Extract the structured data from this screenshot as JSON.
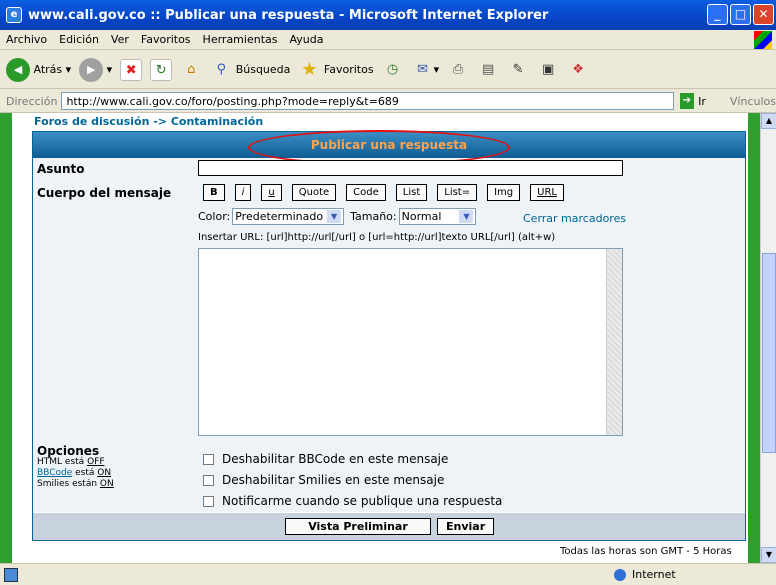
{
  "window": {
    "title": "www.cali.gov.co :: Publicar una respuesta - Microsoft Internet Explorer"
  },
  "menu": [
    "Archivo",
    "Edición",
    "Ver",
    "Favoritos",
    "Herramientas",
    "Ayuda"
  ],
  "toolbar": {
    "back": "Atrás",
    "search": "Búsqueda",
    "favorites": "Favoritos"
  },
  "address": {
    "label": "Dirección",
    "url": "http://www.cali.gov.co/foro/posting.php?mode=reply&t=689",
    "go": "Ir",
    "links": "Vínculos"
  },
  "page": {
    "breadcrumb": "Foros de discusión -> Contaminación",
    "header": "Publicar una respuesta",
    "subject_label": "Asunto",
    "body_label": "Cuerpo del mensaje",
    "format_buttons": [
      "B",
      "i",
      "u",
      "Quote",
      "Code",
      "List",
      "List=",
      "Img",
      "URL"
    ],
    "color_label": "Color:",
    "color_value": "Predeterminado",
    "size_label": "Tamaño:",
    "size_value": "Normal",
    "close_tags": "Cerrar marcadores",
    "hint": "Insertar URL: [url]http://url[/url] o [url=http://url]texto URL[/url]  (alt+w)",
    "options_title": "Opciones",
    "html_status": "HTML está",
    "html_value": "OFF",
    "bbcode_label": "BBCode",
    "bbcode_status": " está ",
    "bbcode_value": "ON",
    "smilies_status": "Smilies están",
    "smilies_value": "ON",
    "check1": "Deshabilitar BBCode en este mensaje",
    "check2": "Deshabilitar Smilies en este mensaje",
    "check3": "Notificarme cuando se publique una respuesta",
    "preview_button": "Vista Preliminar",
    "submit_button": "Enviar",
    "timezone": "Todas las horas son GMT - 5 Horas"
  },
  "status": {
    "zone": "Internet"
  }
}
